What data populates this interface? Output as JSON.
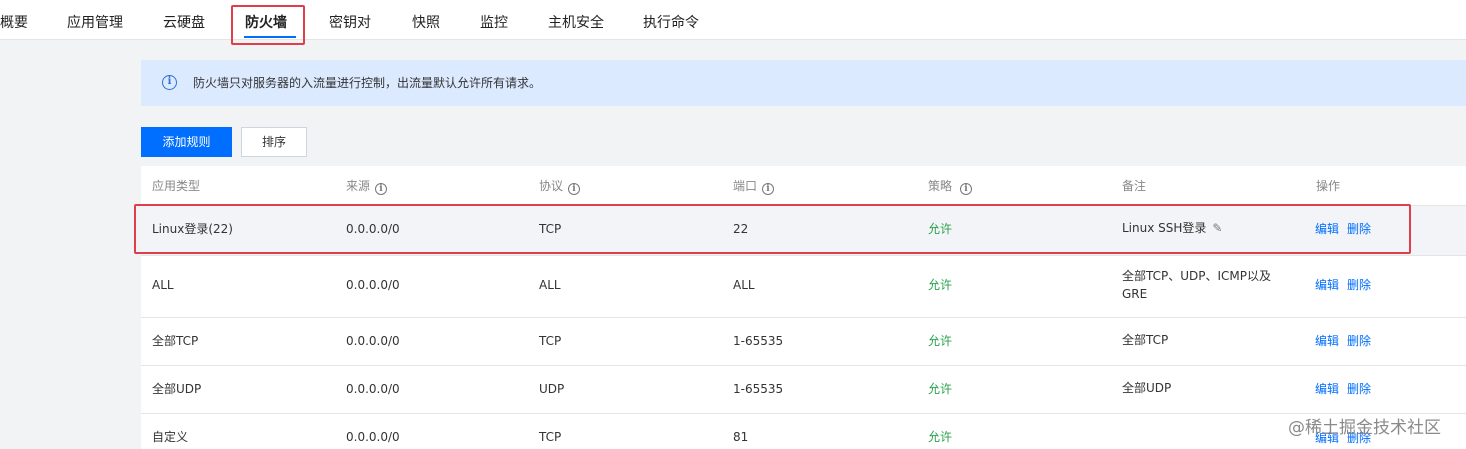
{
  "tabs": [
    {
      "label": "概要",
      "active": false
    },
    {
      "label": "应用管理",
      "active": false
    },
    {
      "label": "云硬盘",
      "active": false
    },
    {
      "label": "防火墙",
      "active": true
    },
    {
      "label": "密钥对",
      "active": false
    },
    {
      "label": "快照",
      "active": false
    },
    {
      "label": "监控",
      "active": false
    },
    {
      "label": "主机安全",
      "active": false
    },
    {
      "label": "执行命令",
      "active": false
    }
  ],
  "notice": {
    "icon": "info-icon",
    "text": "防火墙只对服务器的入流量进行控制，出流量默认允许所有请求。"
  },
  "toolbar": {
    "add_rule_label": "添加规则",
    "sort_label": "排序"
  },
  "table": {
    "headers": [
      "应用类型",
      "来源",
      "协议",
      "端口",
      "策略",
      "备注",
      "操作"
    ],
    "rows": [
      {
        "app_type": "Linux登录(22)",
        "source": "0.0.0.0/0",
        "protocol": "TCP",
        "port": "22",
        "policy": "允许",
        "remark_line1": "Linux SSH登录",
        "remark_line2": ""
      },
      {
        "app_type": "ALL",
        "source": "0.0.0.0/0",
        "protocol": "ALL",
        "port": "ALL",
        "policy": "允许",
        "remark_line1": "全部TCP、UDP、ICMP以及",
        "remark_line2": "GRE"
      },
      {
        "app_type": "全部TCP",
        "source": "0.0.0.0/0",
        "protocol": "TCP",
        "port": "1-65535",
        "policy": "允许",
        "remark_line1": "全部TCP",
        "remark_line2": ""
      },
      {
        "app_type": "全部UDP",
        "source": "0.0.0.0/0",
        "protocol": "UDP",
        "port": "1-65535",
        "policy": "允许",
        "remark_line1": "全部UDP",
        "remark_line2": ""
      },
      {
        "app_type": "自定义",
        "source": "0.0.0.0/0",
        "protocol": "TCP",
        "port": "81",
        "policy": "允许",
        "remark_line1": "",
        "remark_line2": ""
      }
    ],
    "actions": {
      "edit": "编辑",
      "delete": "删除"
    }
  },
  "watermark": "@稀土掘金技术社区",
  "colors": {
    "primary": "#006eff",
    "allow": "#29a24b",
    "highlight": "#e03e4b",
    "notice_bg": "#dceaff"
  }
}
